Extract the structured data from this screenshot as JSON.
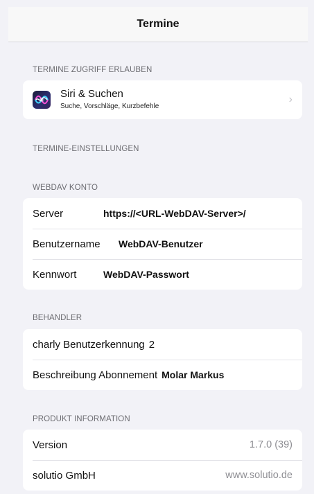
{
  "navbar": {
    "title": "Termine"
  },
  "sections": {
    "access": {
      "header": "TERMINE ZUGRIFF ERLAUBEN",
      "siri": {
        "title": "Siri & Suchen",
        "subtitle": "Suche, Vorschläge, Kurzbefehle",
        "icon": "siri-icon",
        "chevron": "›"
      }
    },
    "settings": {
      "header": "TERMINE-EINSTELLUNGEN"
    },
    "webdav": {
      "header": "WEBDAV KONTO",
      "rows": [
        {
          "label": "Server",
          "value": "https://<URL-WebDAV-Server>/"
        },
        {
          "label": "Benutzername",
          "value": "WebDAV-Benutzer"
        },
        {
          "label": "Kennwort",
          "value": "WebDAV-Passwort"
        }
      ]
    },
    "behandler": {
      "header": "BEHANDLER",
      "rows": [
        {
          "label": "charly Benutzerkennung",
          "value": "2"
        },
        {
          "label": "Beschreibung Abonnement",
          "value": "Molar Markus"
        }
      ]
    },
    "product": {
      "header": "PRODUKT INFORMATION",
      "rows": [
        {
          "label": "Version",
          "value": "1.7.0 (39)"
        },
        {
          "label": "solutio GmbH",
          "value": "www.solutio.de"
        }
      ]
    }
  },
  "colors": {
    "background": "#f2f2f7",
    "card": "#ffffff",
    "header_text": "#6d6d72",
    "muted_text": "#8e8e93"
  }
}
